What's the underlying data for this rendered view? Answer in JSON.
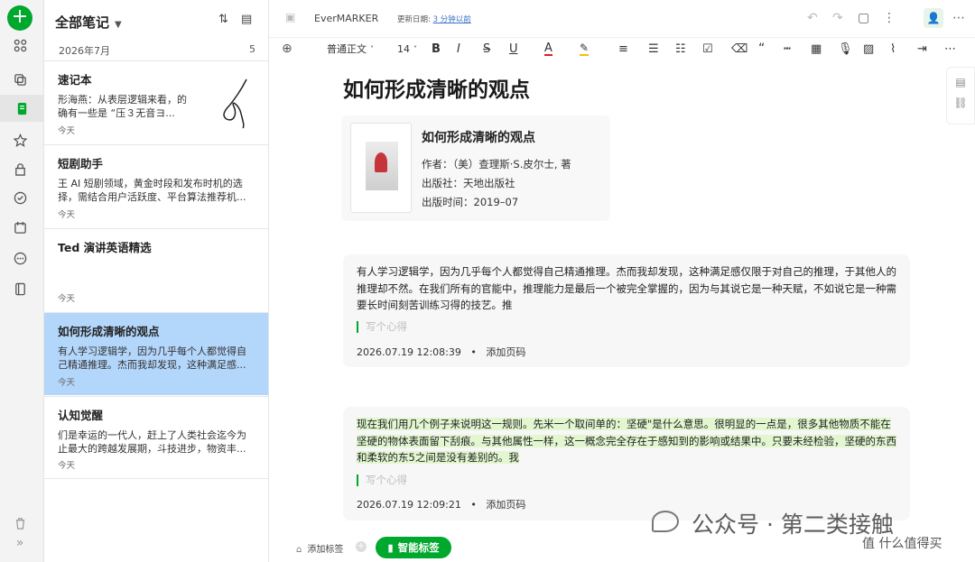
{
  "rail": {
    "add_label": "+"
  },
  "list": {
    "title": "全部笔记",
    "month": "2026年7月",
    "count": "5",
    "notes": [
      {
        "title": "速记本",
        "snippet": "形海燕：从表层逻辑来看，的确有一些是 “压３无音ヨ...",
        "date": "今天"
      },
      {
        "title": "短剧助手",
        "snippet": "王 AI 短剧领域，黄金时段和发布时机的选择，需结合用户活跃度、平台算法推荐机...",
        "date": "今天"
      },
      {
        "title": "Ted 演讲英语精选",
        "snippet": "",
        "date": "今天"
      },
      {
        "title": "如何形成清晰的观点",
        "snippet": "有人学习逻辑学，因为几乎每个人都觉得自己精通推理。杰而我却发现，这种满足感...",
        "date": "今天"
      },
      {
        "title": "认知觉醒",
        "snippet": "们是幸运的一代人，赶上了人类社会迄今为止最大的跨越发展期，斗技进步，物资丰...",
        "date": "今天"
      }
    ]
  },
  "topbar": {
    "app_name": "EverMARKER",
    "updated_label": "更新日期:",
    "updated_value": "3 分钟以前"
  },
  "toolbar": {
    "style": "普通正文",
    "size": "14"
  },
  "editor": {
    "title": "如何形成清晰的观点",
    "book": {
      "title": "如何形成清晰的观点",
      "author": "作者：（美）查理斯·S.皮尔士, 著",
      "publisher": "出版社：天地出版社",
      "pubdate": "出版时间：2019–07"
    },
    "quotes": [
      {
        "text": "有人学习逻辑学，因为几乎每个人都觉得自己精通推理。杰而我却发现，这种满足感仅限于对自己的推理，于其他人的推理却不然。在我们所有的官能中，推理能力是最后一个被完全掌握的，因为与其说它是一种天赋，不如说它是一种需要长时间刻苦训练习得的技艺。推",
        "placeholder": "写个心得",
        "timestamp": "2026.07.19 12:08:39",
        "sep": "•",
        "add_page": "添加页码"
      },
      {
        "text": "现在我们用几个例子来说明这一规则。先米一个取间单的：坚硬\"是什么意思。很明显的一点是，很多其他物质不能在坚硬的物体表面留下刮痕。与其他属性一样，这一概念完全存在于感知到的影响或结果中。只要未经检验，坚硬的东西和柔软的东5之间是没有差别的。我",
        "placeholder": "写个心得",
        "timestamp": "2026.07.19 12:09:21",
        "sep": "•",
        "add_page": "添加页码"
      }
    ]
  },
  "footer": {
    "add_tag": "添加标签",
    "smart_tag": "智能标签"
  },
  "watermark": {
    "main": "公众号 · 第二类接触",
    "sub": "值 什么值得买"
  }
}
